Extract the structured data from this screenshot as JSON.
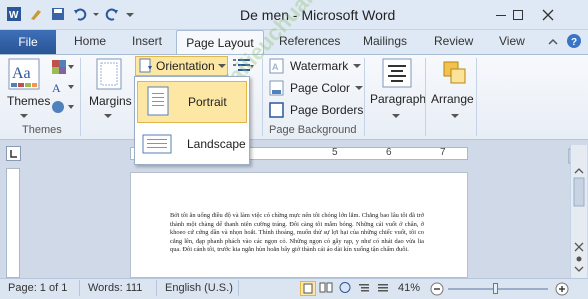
{
  "window": {
    "title": "De men  -  Microsoft Word"
  },
  "tabs": {
    "file": "File",
    "items": [
      "Home",
      "Insert",
      "Page Layout",
      "References",
      "Mailings",
      "Review",
      "View"
    ]
  },
  "ribbon": {
    "themes": "Themes",
    "themes_group": "Themes",
    "margins": "Margins",
    "orientation": "Orientation",
    "watermark": "Watermark",
    "page_color": "Page Color",
    "page_borders": "Page Borders",
    "page_background_group": "Page Background",
    "paragraph": "Paragraph",
    "arrange": "Arrange"
  },
  "orientation_menu": {
    "portrait": "Portrait",
    "landscape": "Landscape"
  },
  "ruler": {
    "numbers": [
      "5",
      "6",
      "7"
    ]
  },
  "document": {
    "paragraph": "Bởi tôi ăn uống điều độ và làm việc có chừng mực nên tôi chóng lớn lắm. Chẳng bao lâu tôi đã trở thành một chàng dế thanh niên cường tráng. Đôi càng tôi mẫm bóng. Những cái vuốt ở chân, ở khoeo cứ cứng dần và nhọn hoắt. Thỉnh thoảng, muốn thử sự lợi hại của những chiếc vuốt, tôi co cẳng lên, đạp phanh phách vào các ngọn cỏ. Những ngọn cỏ gẫy rạp, y như có nhát dao vừa lia qua. Đôi cánh tôi, trước kia ngắn hủn hoẳn bây giờ thành cái áo dài kín xuống tận chấm đuôi."
  },
  "watermark_text": "Tailieuchuahang.info",
  "status": {
    "page": "Page: 1 of 1",
    "words": "Words: 111",
    "language": "English (U.S.)",
    "zoom": "41%"
  },
  "colors": {
    "file_tab": "#2b579a",
    "highlight": "#fde7a5"
  }
}
